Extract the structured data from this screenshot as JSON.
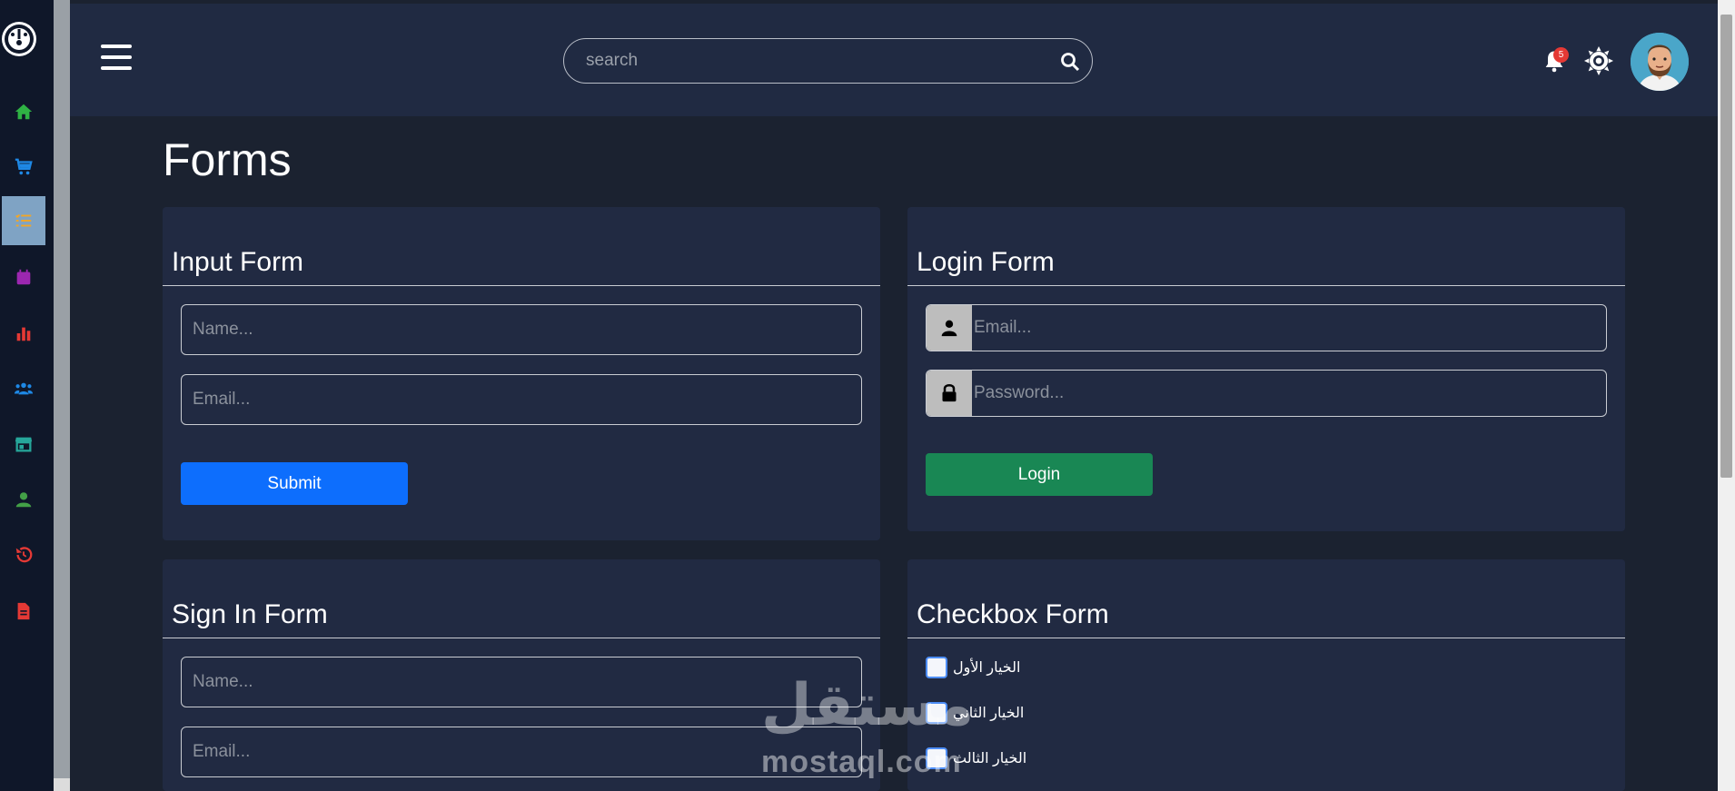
{
  "header": {
    "search_placeholder": "search",
    "notification_count": "5"
  },
  "sidebar": {
    "items": [
      {
        "icon": "home-icon",
        "color": "#2fb344"
      },
      {
        "icon": "cart-icon",
        "color": "#1e88e5"
      },
      {
        "icon": "list-icon",
        "color": "#f5a623",
        "active": true
      },
      {
        "icon": "calendar-icon",
        "color": "#9c27b0"
      },
      {
        "icon": "bar-chart-icon",
        "color": "#e53935"
      },
      {
        "icon": "users-icon",
        "color": "#1e88e5"
      },
      {
        "icon": "store-icon",
        "color": "#26a69a"
      },
      {
        "icon": "user-icon",
        "color": "#43a047"
      },
      {
        "icon": "history-icon",
        "color": "#e53935"
      },
      {
        "icon": "file-icon",
        "color": "#e53935"
      }
    ]
  },
  "main": {
    "title": "Forms",
    "input_form": {
      "title": "Input Form",
      "name_placeholder": "Name...",
      "email_placeholder": "Email...",
      "submit_label": "Submit"
    },
    "login_form": {
      "title": "Login Form",
      "email_placeholder": "Email...",
      "password_placeholder": "Password...",
      "login_label": "Login"
    },
    "signin_form": {
      "title": "Sign In Form",
      "name_placeholder": "Name...",
      "email_placeholder": "Email..."
    },
    "checkbox_form": {
      "title": "Checkbox Form",
      "options": [
        "الخيار الأول",
        "الخيار الثاني",
        "الخيار الثالث"
      ]
    }
  },
  "watermark": {
    "arabic": "مستقل",
    "latin": "mostaql.com"
  },
  "colors": {
    "background": "#1b2230",
    "card": "#212a42",
    "header": "#202a42",
    "sidebar": "#0f1729",
    "submit": "#0d6efd",
    "login": "#198754"
  }
}
